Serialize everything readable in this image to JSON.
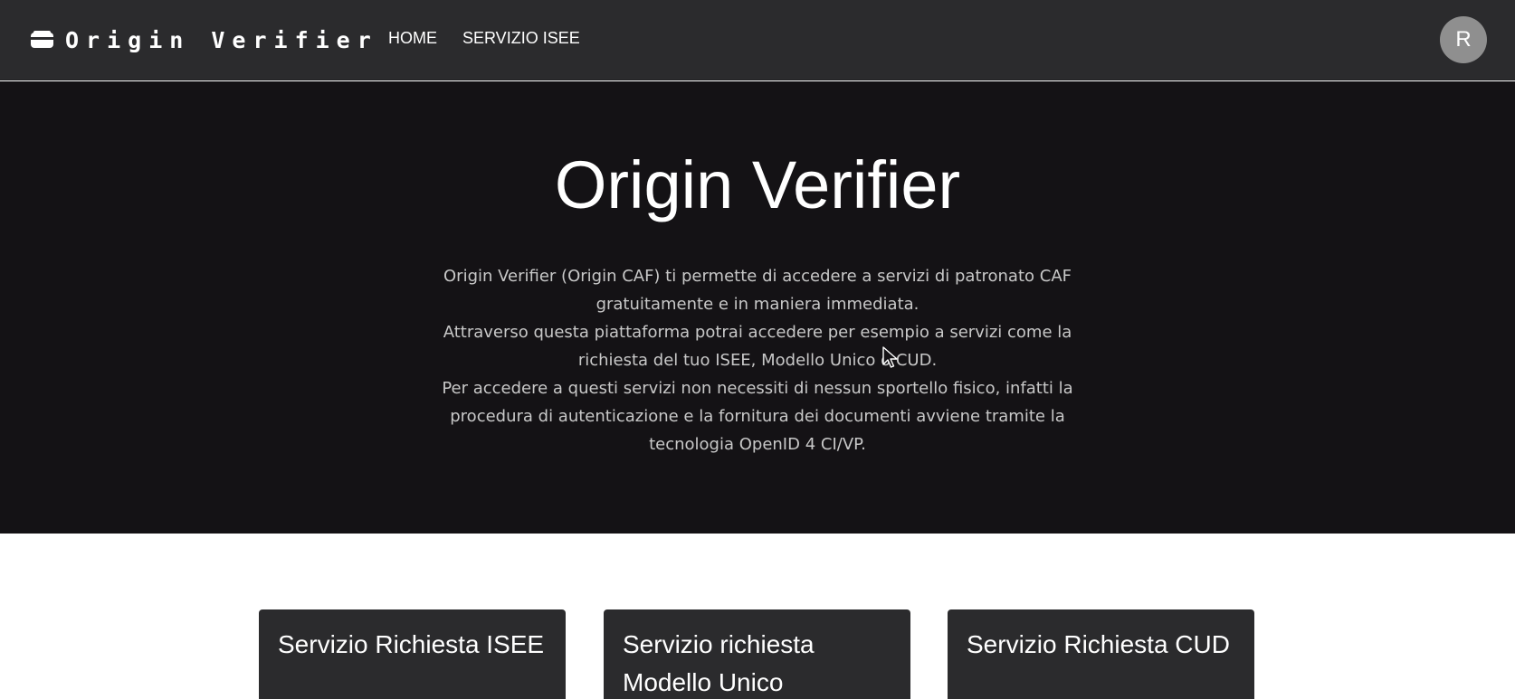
{
  "navbar": {
    "brand_icon": "wallet-icon",
    "brand": "Origin Verifier",
    "links": [
      "HOME",
      "SERVIZIO ISEE"
    ],
    "avatar_initial": "R"
  },
  "hero": {
    "title": "Origin Verifier",
    "paragraphs": [
      "Origin Verifier (Origin CAF) ti permette di accedere a servizi di patronato CAF gratuitamente e in maniera immediata.",
      "Attraverso questa piattaforma potrai accedere per esempio a servizi come la richiesta del tuo ISEE, Modello Unico o CUD.",
      "Per accedere a questi servizi non necessiti di nessun sportello fisico, infatti la procedura di autenticazione e la fornitura dei documenti avviene tramite la tecnologia OpenID 4 CI/VP."
    ]
  },
  "cards": [
    {
      "title": "Servizio Richiesta ISEE"
    },
    {
      "title": "Servizio richiesta Modello Unico"
    },
    {
      "title": "Servizio Richiesta CUD"
    }
  ],
  "colors": {
    "navbar_bg": "#2b2b2d",
    "hero_bg": "#141215",
    "card_bg": "#2b2b2d",
    "avatar_bg": "#8f8f8f"
  }
}
